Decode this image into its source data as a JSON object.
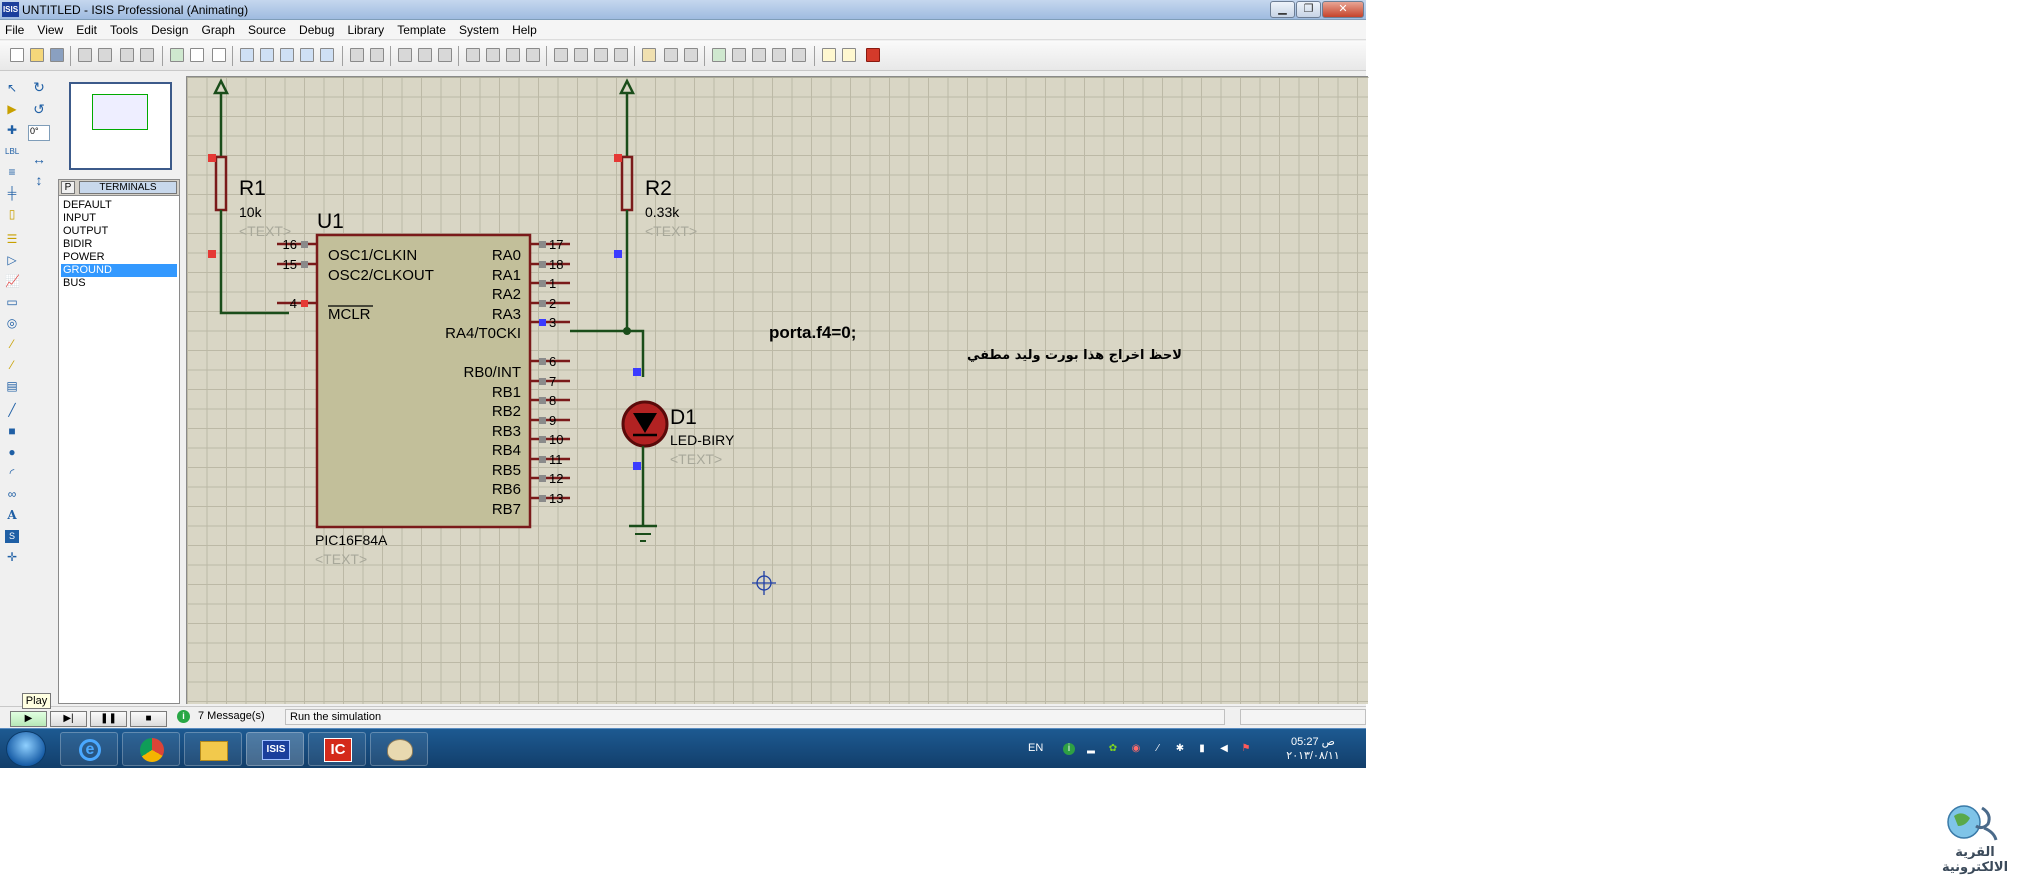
{
  "window": {
    "app_icon_text": "ISIS",
    "title": "UNTITLED - ISIS Professional (Animating)"
  },
  "menu": [
    "File",
    "View",
    "Edit",
    "Tools",
    "Design",
    "Graph",
    "Source",
    "Debug",
    "Library",
    "Template",
    "System",
    "Help"
  ],
  "angle_field": "0°",
  "terminals": {
    "tab_p": "P",
    "tab_title": "TERMINALS",
    "items": [
      "DEFAULT",
      "INPUT",
      "OUTPUT",
      "BIDIR",
      "POWER",
      "GROUND",
      "BUS"
    ],
    "selected": "GROUND"
  },
  "schematic": {
    "r1": {
      "ref": "R1",
      "value": "10k",
      "text": "<TEXT>"
    },
    "r2": {
      "ref": "R2",
      "value": "0.33k",
      "text": "<TEXT>"
    },
    "u1": {
      "ref": "U1",
      "part": "PIC16F84A",
      "text": "<TEXT>"
    },
    "d1": {
      "ref": "D1",
      "part": "LED-BIRY",
      "text": "<TEXT>"
    },
    "left_pins": [
      {
        "num": "16",
        "name": "OSC1/CLKIN"
      },
      {
        "num": "15",
        "name": "OSC2/CLKOUT"
      },
      {
        "num": "4",
        "name": "MCLR"
      }
    ],
    "right_pins": [
      {
        "num": "17",
        "name": "RA0"
      },
      {
        "num": "18",
        "name": "RA1"
      },
      {
        "num": "1",
        "name": "RA2"
      },
      {
        "num": "2",
        "name": "RA3"
      },
      {
        "num": "3",
        "name": "RA4/T0CKI"
      },
      {
        "num": "6",
        "name": "RB0/INT"
      },
      {
        "num": "7",
        "name": "RB1"
      },
      {
        "num": "8",
        "name": "RB2"
      },
      {
        "num": "9",
        "name": "RB3"
      },
      {
        "num": "10",
        "name": "RB4"
      },
      {
        "num": "11",
        "name": "RB5"
      },
      {
        "num": "12",
        "name": "RB6"
      },
      {
        "num": "13",
        "name": "RB7"
      }
    ],
    "note_line1": "porta.f4=0;",
    "note_line2": "لاحظ اخراج هذا بورت وليد مطفي"
  },
  "status": {
    "tooltip": "Play",
    "messages": "7 Message(s)",
    "text": "Run the simulation"
  },
  "taskbar": {
    "lang": "EN",
    "time": "05:27 ص",
    "date": "٢٠١٣/٠٨/١١"
  },
  "watermark": {
    "text": "القرية الالكترونية"
  },
  "colors": {
    "canvas": "#d9d6c5",
    "wire": "#1a4d1a",
    "component": "#7a1a1a",
    "selection": "#3399ff"
  }
}
